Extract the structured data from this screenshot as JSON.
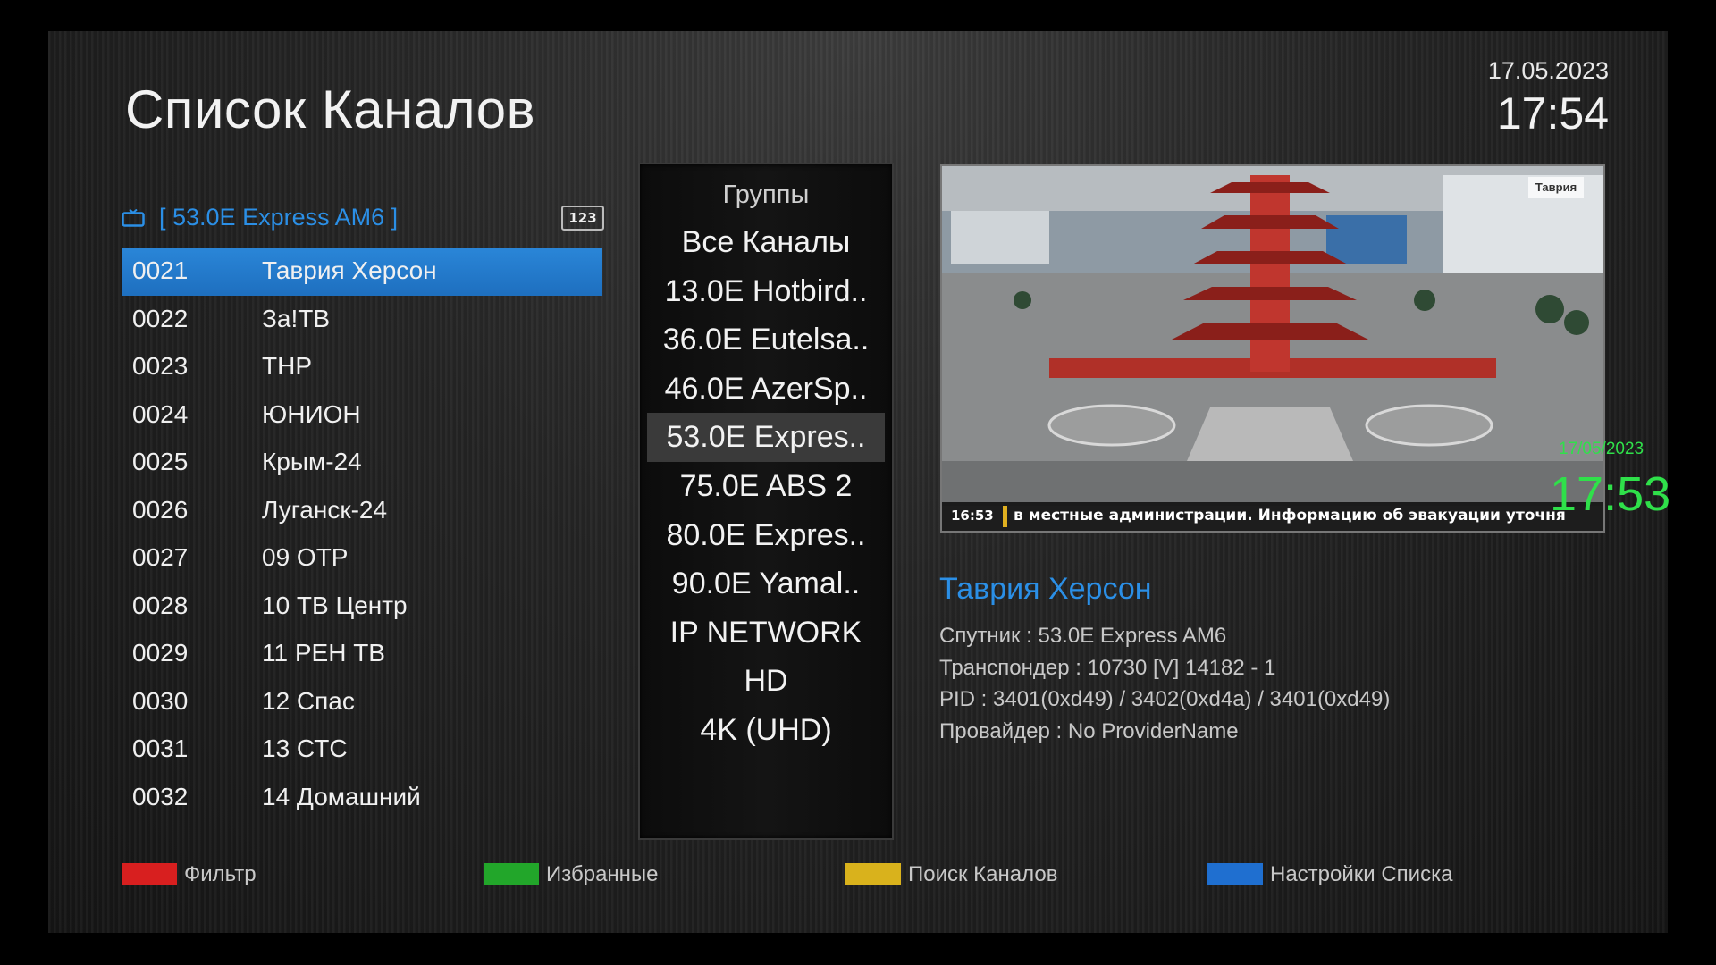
{
  "header": {
    "title": "Список Каналов",
    "date": "17.05.2023",
    "time": "17:54"
  },
  "channel_list": {
    "satellite_label": "[ 53.0E Express AM6 ]",
    "satellite_icon": "tv-icon",
    "badge": "123",
    "channels": [
      {
        "number": "0021",
        "name": "Таврия Херсон",
        "selected": true
      },
      {
        "number": "0022",
        "name": "За!ТВ"
      },
      {
        "number": "0023",
        "name": "ТНР"
      },
      {
        "number": "0024",
        "name": "ЮНИОН"
      },
      {
        "number": "0025",
        "name": "Крым-24"
      },
      {
        "number": "0026",
        "name": "Луганск-24"
      },
      {
        "number": "0027",
        "name": "09 ОТР"
      },
      {
        "number": "0028",
        "name": "10 ТВ Центр"
      },
      {
        "number": "0029",
        "name": "11 РЕН ТВ"
      },
      {
        "number": "0030",
        "name": "12 Спас"
      },
      {
        "number": "0031",
        "name": "13 СТС"
      },
      {
        "number": "0032",
        "name": "14 Домашний"
      }
    ]
  },
  "groups": {
    "title": "Группы",
    "items": [
      {
        "label": "Все Каналы"
      },
      {
        "label": "13.0E Hotbird.."
      },
      {
        "label": "36.0E Eutelsa.."
      },
      {
        "label": "46.0E AzerSp.."
      },
      {
        "label": "53.0E Expres..",
        "selected": true
      },
      {
        "label": "75.0E ABS 2"
      },
      {
        "label": "80.0E Expres.."
      },
      {
        "label": "90.0E Yamal.."
      },
      {
        "label": "IP NETWORK"
      },
      {
        "label": "HD"
      },
      {
        "label": "4K (UHD)"
      }
    ]
  },
  "preview": {
    "ticker_time": "16:53",
    "ticker_text": "в местные администрации. Информацию об эвакуации уточня",
    "logo": "Таврия",
    "osd_date": "17/05/2023",
    "osd_time": "17:53"
  },
  "info": {
    "channel_name": "Таврия Херсон",
    "satellite": "Спутник : 53.0E Express AM6",
    "transponder": "Транспондер : 10730 [V] 14182 - 1",
    "pid": "PID : 3401(0xd49) / 3402(0xd4a) / 3401(0xd49)",
    "provider": "Провайдер : No ProviderName"
  },
  "legend": [
    {
      "label": "Фильтр",
      "color": "#d81f1f"
    },
    {
      "label": "Избранные",
      "color": "#22a62a"
    },
    {
      "label": "Поиск Каналов",
      "color": "#d9b21c"
    },
    {
      "label": "Настройки Списка",
      "color": "#1f6fd0"
    }
  ],
  "colors": {
    "accent": "#2b8fe6",
    "osd_green": "#2fe04a"
  }
}
